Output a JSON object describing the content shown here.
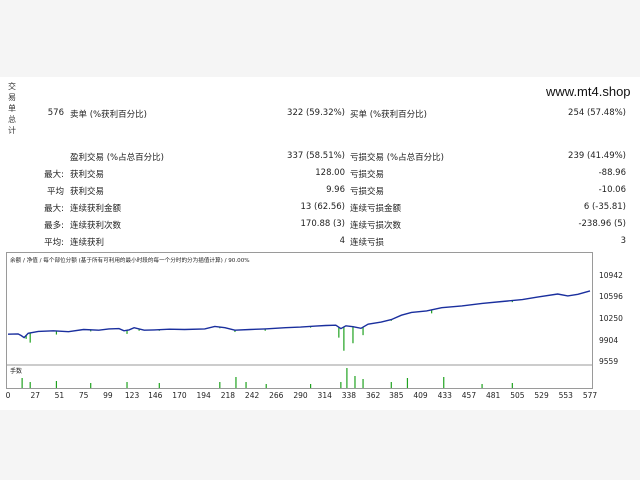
{
  "side_label": [
    "交",
    "易",
    "单",
    "总",
    "计"
  ],
  "watermark": "www.mt4.shop",
  "summary": {
    "total_trades": "576",
    "short_label": "卖单 (%获利百分比)",
    "short_value": "322 (59.32%)",
    "long_label": "买单 (%获利百分比)",
    "long_value": "254 (57.48%)",
    "profit_trades_label": "盈利交易 (%占总百分比)",
    "profit_trades_value": "337 (58.51%)",
    "loss_trades_label": "亏损交易 (%占总百分比)",
    "loss_trades_value": "239 (41.49%)",
    "largest_prefix": "最大:",
    "largest_profit_label": "获利交易",
    "largest_profit_value": "128.00",
    "largest_loss_label": "亏损交易",
    "largest_loss_value": "-88.96",
    "average_prefix": "平均",
    "average_profit_label": "获利交易",
    "average_profit_value": "9.96",
    "average_loss_label": "亏损交易",
    "average_loss_value": "-10.06",
    "max_prefix": "最大:",
    "max_consec_wins_label": "连续获利金额",
    "max_consec_wins_value": "13 (62.56)",
    "max_consec_losses_label": "连续亏损金额",
    "max_consec_losses_value": "6 (-35.81)",
    "maximal_prefix": "最多:",
    "maximal_consec_profit_label": "连续获利次数",
    "maximal_consec_profit_value": "170.88 (3)",
    "maximal_consec_loss_label": "连续亏损次数",
    "maximal_consec_loss_value": "-238.96 (5)",
    "avg_consec_prefix": "平均:",
    "avg_consec_wins_label": "连续获利",
    "avg_consec_wins_value": "4",
    "avg_consec_losses_label": "连续亏损",
    "avg_consec_losses_value": "3"
  },
  "chart_data": {
    "type": "line",
    "legend_text": "余额 / 净值 / 每个部位分额 (基于所有可利用的最小时段的每一个分时的分为插值计算) / 90.00%",
    "legend_colors": {
      "balance": "#1a2f9e",
      "equity": "#1fa21f"
    },
    "ylim": [
      9559,
      11100
    ],
    "yticks": [
      "10942",
      "10596",
      "10250",
      "9904",
      "9559"
    ],
    "xticks": [
      "0",
      "27",
      "51",
      "75",
      "99",
      "123",
      "146",
      "170",
      "194",
      "218",
      "242",
      "266",
      "290",
      "314",
      "338",
      "362",
      "385",
      "409",
      "433",
      "457",
      "481",
      "505",
      "529",
      "553",
      "577"
    ],
    "xlim": [
      0,
      577
    ],
    "subpanel_label": "手数",
    "balance": [
      [
        0,
        10005
      ],
      [
        10,
        10010
      ],
      [
        13,
        9985
      ],
      [
        16,
        9950
      ],
      [
        20,
        10020
      ],
      [
        30,
        10050
      ],
      [
        45,
        10060
      ],
      [
        60,
        10045
      ],
      [
        75,
        10080
      ],
      [
        90,
        10070
      ],
      [
        100,
        10090
      ],
      [
        110,
        10095
      ],
      [
        115,
        10060
      ],
      [
        120,
        10075
      ],
      [
        125,
        10110
      ],
      [
        135,
        10070
      ],
      [
        145,
        10075
      ],
      [
        160,
        10085
      ],
      [
        175,
        10080
      ],
      [
        195,
        10090
      ],
      [
        205,
        10130
      ],
      [
        215,
        10110
      ],
      [
        225,
        10070
      ],
      [
        240,
        10080
      ],
      [
        255,
        10090
      ],
      [
        265,
        10100
      ],
      [
        275,
        10110
      ],
      [
        290,
        10120
      ],
      [
        305,
        10135
      ],
      [
        315,
        10145
      ],
      [
        325,
        10150
      ],
      [
        330,
        10095
      ],
      [
        335,
        10140
      ],
      [
        342,
        10125
      ],
      [
        350,
        10100
      ],
      [
        357,
        10165
      ],
      [
        370,
        10200
      ],
      [
        380,
        10240
      ],
      [
        390,
        10310
      ],
      [
        400,
        10355
      ],
      [
        415,
        10380
      ],
      [
        430,
        10430
      ],
      [
        450,
        10460
      ],
      [
        470,
        10500
      ],
      [
        490,
        10530
      ],
      [
        510,
        10560
      ],
      [
        525,
        10600
      ],
      [
        545,
        10650
      ],
      [
        555,
        10620
      ],
      [
        565,
        10645
      ],
      [
        577,
        10700
      ]
    ],
    "equity_spikes": [
      [
        18,
        9930
      ],
      [
        22,
        9870
      ],
      [
        48,
        10000
      ],
      [
        82,
        10050
      ],
      [
        118,
        10010
      ],
      [
        130,
        10060
      ],
      [
        150,
        10060
      ],
      [
        210,
        10100
      ],
      [
        225,
        10040
      ],
      [
        255,
        10060
      ],
      [
        300,
        10110
      ],
      [
        328,
        9950
      ],
      [
        333,
        9740
      ],
      [
        342,
        9860
      ],
      [
        352,
        9990
      ],
      [
        380,
        10220
      ],
      [
        420,
        10340
      ],
      [
        470,
        10490
      ],
      [
        500,
        10520
      ]
    ],
    "lots": [
      [
        14,
        0.5
      ],
      [
        22,
        0.3
      ],
      [
        48,
        0.35
      ],
      [
        82,
        0.25
      ],
      [
        118,
        0.3
      ],
      [
        150,
        0.25
      ],
      [
        210,
        0.3
      ],
      [
        226,
        0.55
      ],
      [
        236,
        0.3
      ],
      [
        256,
        0.2
      ],
      [
        300,
        0.2
      ],
      [
        330,
        0.3
      ],
      [
        336,
        1.0
      ],
      [
        344,
        0.6
      ],
      [
        352,
        0.45
      ],
      [
        380,
        0.3
      ],
      [
        396,
        0.5
      ],
      [
        432,
        0.55
      ],
      [
        470,
        0.2
      ],
      [
        500,
        0.25
      ]
    ]
  }
}
